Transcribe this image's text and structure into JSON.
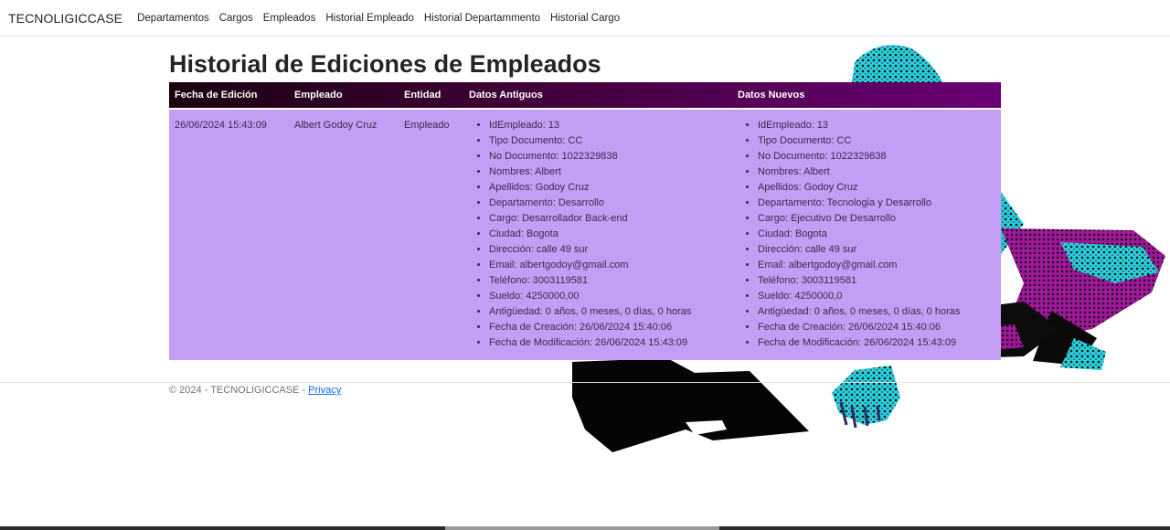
{
  "nav": {
    "brand": "TECNOLIGICCASE",
    "links": [
      "Departamentos",
      "Cargos",
      "Empleados",
      "Historial Empleado",
      "Historial Departammento",
      "Historial Cargo"
    ]
  },
  "page": {
    "title": "Historial de Ediciones de Empleados"
  },
  "table": {
    "headers": [
      "Fecha de Edición",
      "Empleado",
      "Entidad",
      "Datos Antiguos",
      "Datos Nuevos"
    ],
    "row": {
      "fecha": "26/06/2024 15:43:09",
      "empleado": "Albert Godoy Cruz",
      "entidad": "Empleado",
      "antiguos": [
        "IdEmpleado: 13",
        "Tipo Documento: CC",
        "No Documento: 1022329838",
        "Nombres: Albert",
        "Apellidos: Godoy Cruz",
        "Departamento: Desarrollo",
        "Cargo: Desarrollador Back-end",
        "Ciudad: Bogota",
        "Dirección: calle 49 sur",
        "Email: albertgodoy@gmail.com",
        "Teléfono: 3003119581",
        "Sueldo: 4250000,00",
        "Antigüedad: 0 años, 0 meses, 0 días, 0 horas",
        "Fecha de Creación: 26/06/2024 15:40:06",
        "Fecha de Modificación: 26/06/2024 15:43:09"
      ],
      "nuevos": [
        "IdEmpleado: 13",
        "Tipo Documento: CC",
        "No Documento: 1022329838",
        "Nombres: Albert",
        "Apellidos: Godoy Cruz",
        "Departamento: Tecnologia y Desarrollo",
        "Cargo: Ejecutivo De Desarrollo",
        "Ciudad: Bogota",
        "Dirección: calle 49 sur",
        "Email: albertgodoy@gmail.com",
        "Teléfono: 3003119581",
        "Sueldo: 4250000,0",
        "Antigüedad: 0 años, 0 meses, 0 días, 0 horas",
        "Fecha de Creación: 26/06/2024 15:40:06",
        "Fecha de Modificación: 26/06/2024 15:43:09"
      ]
    }
  },
  "footer": {
    "text": "© 2024 - TECNOLIGICCASE - ",
    "link": "Privacy"
  },
  "colors": {
    "header_start": "#1a0010",
    "header_end": "#6a0075",
    "row_bg": "#c39ef5",
    "art_cyan": "#22e5e5",
    "art_magenta": "#c21aa8"
  }
}
